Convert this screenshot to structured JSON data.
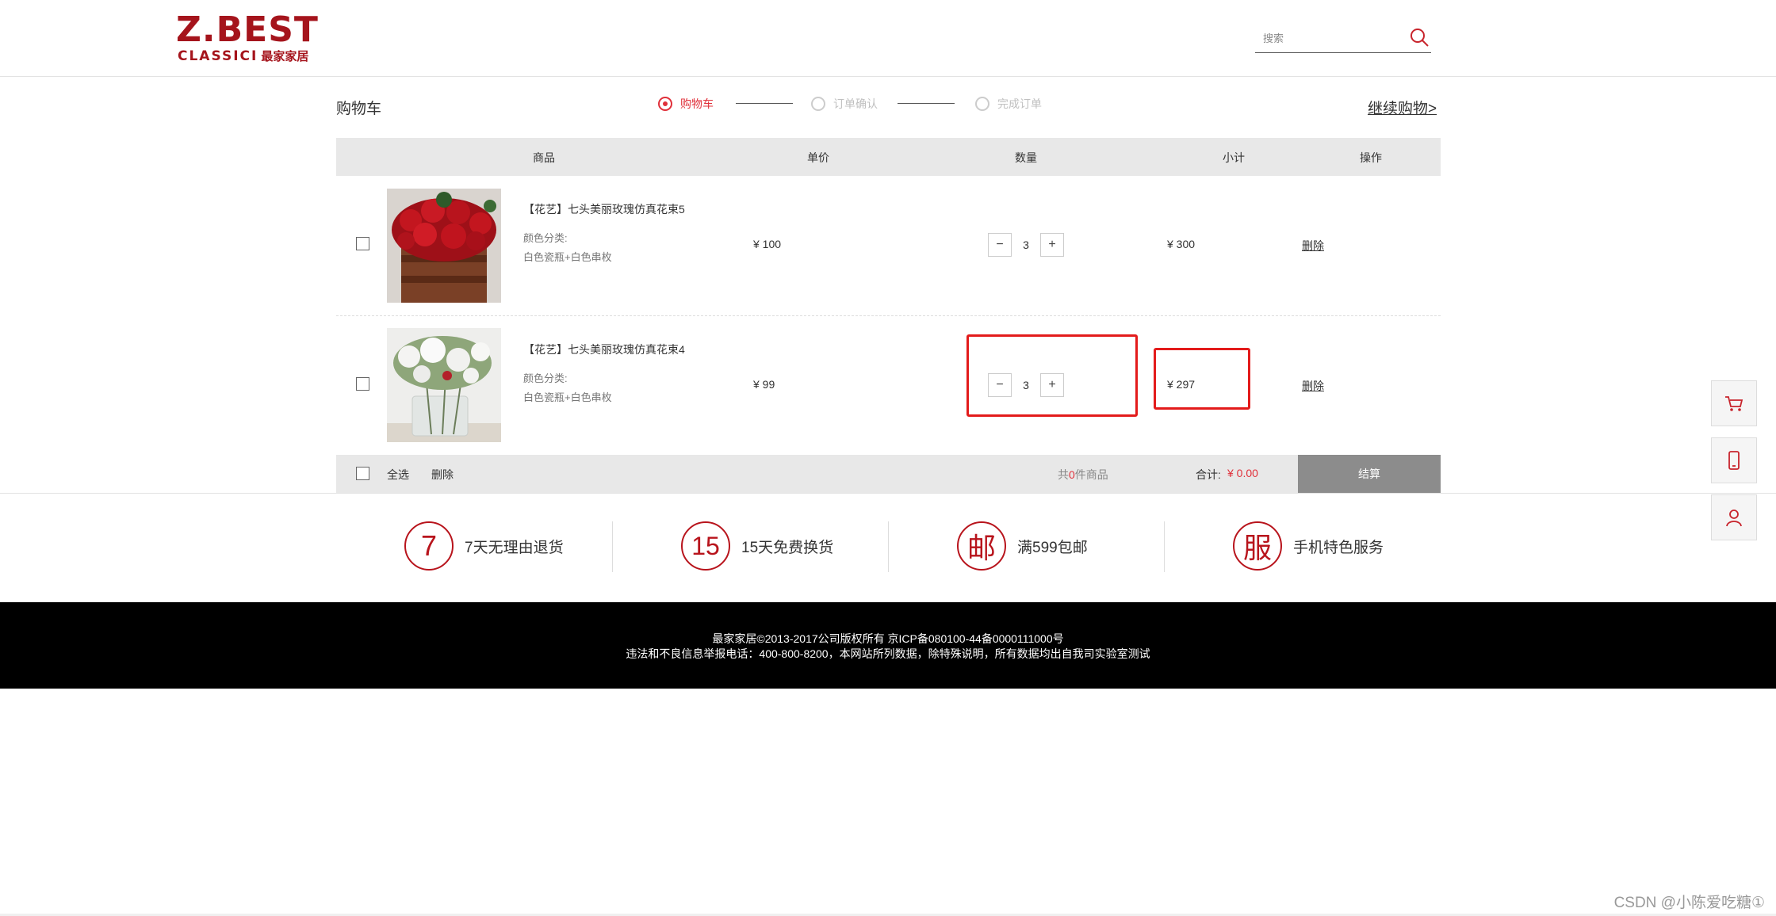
{
  "header": {
    "logo_main": "Z.BEST",
    "logo_sub_en": "CLASSICI",
    "logo_sub_cn": "最家家居",
    "search_placeholder": "搜索"
  },
  "cart": {
    "title": "购物车",
    "continue_label": "继续购物>",
    "steps": [
      {
        "label": "购物车",
        "active": true
      },
      {
        "label": "订单确认",
        "active": false
      },
      {
        "label": "完成订单",
        "active": false
      }
    ],
    "columns": [
      "商品",
      "单价",
      "数量",
      "小计",
      "操作"
    ],
    "items": [
      {
        "name": "【花艺】七头美丽玫瑰仿真花束5",
        "class_label": "颜色分类:",
        "color": "白色瓷瓶+白色串枚",
        "price": "¥ 100",
        "quantity": "3",
        "subtotal": "¥ 300",
        "delete_label": "删除"
      },
      {
        "name": "【花艺】七头美丽玫瑰仿真花束4",
        "class_label": "颜色分类:",
        "color": "白色瓷瓶+白色串枚",
        "price": "¥ 99",
        "quantity": "3",
        "subtotal": "¥ 297",
        "delete_label": "删除"
      }
    ],
    "footer": {
      "select_all": "全选",
      "delete_label": "删除",
      "count_prefix": "共",
      "count": "0",
      "count_suffix": "件商品",
      "total_label": "合计:",
      "total_value": "¥ 0.00",
      "checkout_label": "结算"
    }
  },
  "services": [
    {
      "glyph": "7",
      "label": "7天无理由退货"
    },
    {
      "glyph": "15",
      "label": "15天免费换货"
    },
    {
      "glyph": "邮",
      "label": "满599包邮"
    },
    {
      "glyph": "服",
      "label": "手机特色服务"
    }
  ],
  "footer": {
    "line1": "最家家居©2013-2017公司版权所有 京ICP备080100-44备0000111000号",
    "line2": "违法和不良信息举报电话：400-800-8200，本网站所列数据，除特殊说明，所有数据均出自我司实验室测试"
  },
  "side_tools": [
    "cart-icon",
    "mobile-icon",
    "user-icon"
  ],
  "watermark": "CSDN @小陈爱吃糖①",
  "colors": {
    "accent": "#e0303a",
    "brand": "#a5141c",
    "highlight": "#e31b1b"
  }
}
